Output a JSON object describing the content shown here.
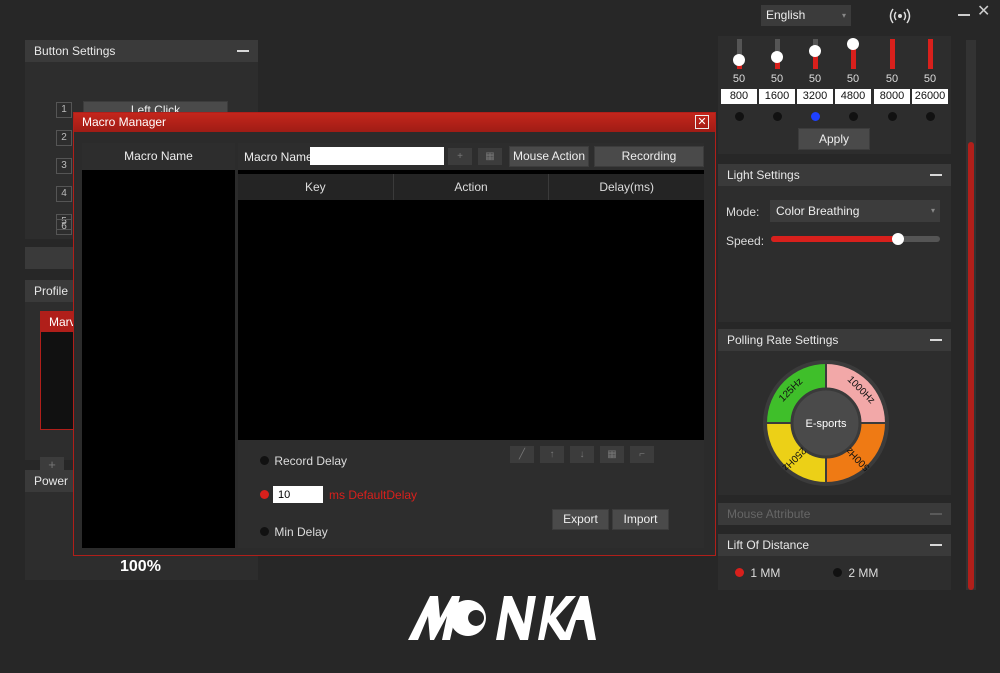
{
  "topbar": {
    "language": "English"
  },
  "button_settings": {
    "title": "Button Settings",
    "rows": [
      {
        "num": "1",
        "label": "Left Click"
      },
      {
        "num": "2",
        "label": ""
      },
      {
        "num": "3",
        "label": ""
      },
      {
        "num": "4",
        "label": ""
      },
      {
        "num": "5",
        "label": ""
      },
      {
        "num": "6",
        "label": ""
      }
    ]
  },
  "profile": {
    "title": "Profile",
    "selected_item": "Marv"
  },
  "power": {
    "title": "Power",
    "value": "100%"
  },
  "dpi": {
    "levels": [
      {
        "pct": "50",
        "value": "800",
        "active": false,
        "fill": 0.3
      },
      {
        "pct": "50",
        "value": "1600",
        "active": false,
        "fill": 0.4
      },
      {
        "pct": "50",
        "value": "3200",
        "active": true,
        "fill": 0.6
      },
      {
        "pct": "50",
        "value": "4800",
        "active": false,
        "fill": 0.85
      },
      {
        "pct": "50",
        "value": "8000",
        "active": false,
        "fill": 1.0
      },
      {
        "pct": "50",
        "value": "26000",
        "active": false,
        "fill": 1.0
      }
    ],
    "apply_label": "Apply"
  },
  "light_settings": {
    "title": "Light Settings",
    "mode_label": "Mode:",
    "mode_value": "Color Breathing",
    "speed_label": "Speed:",
    "speed_level": 0.75
  },
  "polling": {
    "title": "Polling Rate Settings",
    "center_label": "E-sports",
    "rates": [
      "125Hz",
      "1000Hz",
      "500Hz",
      "250Hz"
    ]
  },
  "mouse_attribute": {
    "title": "Mouse Attribute"
  },
  "lift_distance": {
    "title": "Lift Of Distance",
    "opt1": "1 MM",
    "opt2": "2 MM"
  },
  "logo": {
    "text": "MONKA"
  },
  "macro_manager": {
    "title": "Macro Manager",
    "list_header": "Macro Name",
    "name_label": "Macro Name",
    "name_value": "",
    "mouse_action_label": "Mouse Action",
    "recording_label": "Recording",
    "columns": [
      "Key",
      "Action",
      "Delay(ms)"
    ],
    "record_delay_label": "Record Delay",
    "default_delay_value": "10",
    "default_delay_label": "ms DefaultDelay",
    "min_delay_label": "Min Delay",
    "export_label": "Export",
    "import_label": "Import"
  },
  "colors": {
    "accent_red": "#d8201c",
    "active_blue": "#1e40ff",
    "polling_green": "#3fbf2a",
    "polling_pink": "#f2a8a8",
    "polling_orange": "#ef7a14",
    "polling_yellow": "#ecd017"
  }
}
